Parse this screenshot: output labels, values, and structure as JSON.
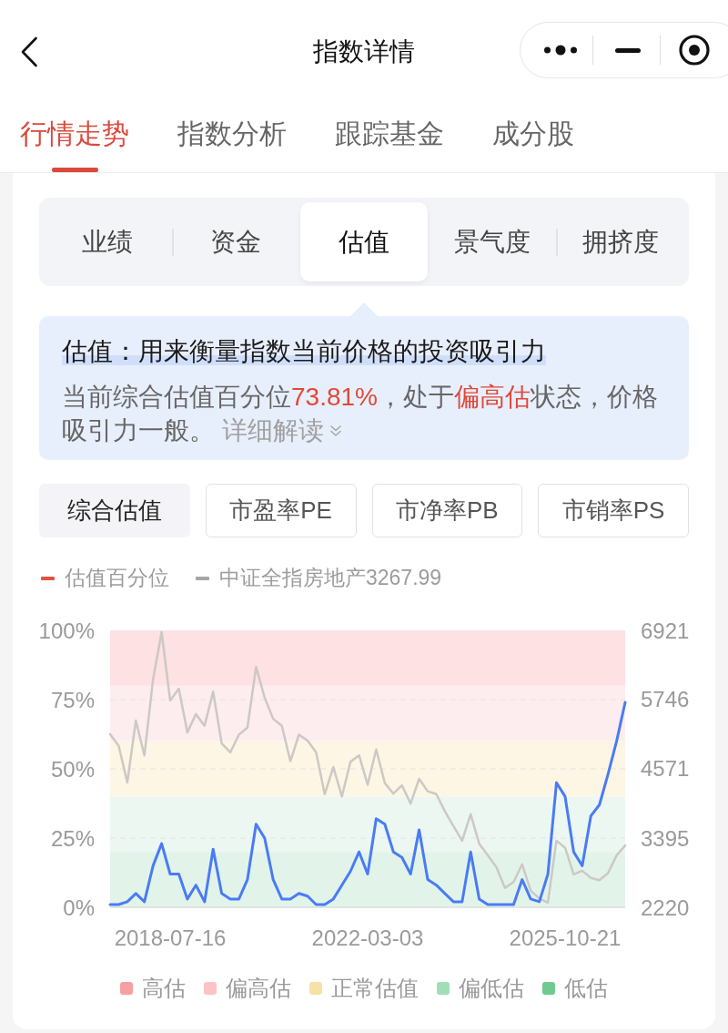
{
  "header": {
    "title": "指数详情"
  },
  "main_tabs": [
    {
      "label": "行情走势",
      "selected": true
    },
    {
      "label": "指数分析",
      "selected": false
    },
    {
      "label": "跟踪基金",
      "selected": false
    },
    {
      "label": "成分股",
      "selected": false
    }
  ],
  "section_tabs": [
    {
      "label": "业绩",
      "selected": false
    },
    {
      "label": "资金",
      "selected": false
    },
    {
      "label": "估值",
      "selected": true
    },
    {
      "label": "景气度",
      "selected": false
    },
    {
      "label": "拥挤度",
      "selected": false
    }
  ],
  "info": {
    "title": "估值：用来衡量指数当前价格的投资吸引力",
    "body": [
      {
        "text": "当前综合估值百分位",
        "emphasis": false
      },
      {
        "text": "73.81%",
        "emphasis": true
      },
      {
        "text": "，处于",
        "emphasis": false
      },
      {
        "text": "偏高估",
        "emphasis": true
      },
      {
        "text": "状态，价格吸引力一般。",
        "emphasis": false
      }
    ],
    "link": "详细解读"
  },
  "metric_tabs": [
    {
      "label": "综合估值",
      "selected": true
    },
    {
      "label": "市盈率PE",
      "selected": false
    },
    {
      "label": "市净率PB",
      "selected": false
    },
    {
      "label": "市销率PS",
      "selected": false
    }
  ],
  "chart": {
    "legend": [
      {
        "color": "#e0533f"
      },
      {
        "color": "#a6a6a6"
      }
    ],
    "chart_data": {
      "type": "line",
      "grid": true,
      "categories": [
        null,
        null,
        null,
        null,
        null,
        null,
        null,
        "2018-07-16",
        null,
        null,
        null,
        null,
        null,
        null,
        null,
        null,
        null,
        null,
        null,
        null,
        null,
        null,
        null,
        null,
        null,
        null,
        null,
        null,
        null,
        null,
        "2022-03-03",
        null,
        null,
        null,
        null,
        null,
        null,
        null,
        null,
        null,
        null,
        null,
        null,
        null,
        null,
        null,
        null,
        null,
        null,
        null,
        null,
        null,
        null,
        "2025-10-21",
        null,
        null,
        null,
        null,
        null,
        null,
        null
      ],
      "ylim": [
        0,
        100
      ],
      "yticks": [
        {
          "value": 0,
          "label": "0%"
        },
        {
          "value": 25,
          "label": "25%"
        },
        {
          "value": 50,
          "label": "50%"
        },
        {
          "value": 75,
          "label": "75%"
        },
        {
          "value": 100,
          "label": "100%"
        }
      ],
      "y2lim": [
        2220,
        6921
      ],
      "y2ticks": [
        2220,
        3395,
        4571,
        5746,
        6921
      ],
      "series": [
        {
          "name": "估值百分位",
          "color": "#4a7bf5",
          "values": [
            1,
            1,
            2,
            5,
            2,
            15,
            23,
            12,
            12,
            3,
            8,
            2,
            21,
            5,
            3,
            3,
            10,
            30,
            25,
            10,
            3,
            3,
            5,
            4,
            1,
            1,
            3,
            8,
            13,
            20,
            12,
            32,
            30,
            20,
            18,
            12,
            28,
            10,
            8,
            5,
            2,
            2,
            20,
            3,
            1,
            1,
            1,
            1,
            10,
            3,
            2,
            12,
            45,
            40,
            20,
            15,
            33,
            37,
            48,
            60,
            74
          ]
        },
        {
          "name": "中证全指房地产3267.99",
          "color": "#ccc8c6",
          "axis": "y2",
          "values": [
            5160,
            4960,
            4340,
            5390,
            4800,
            6090,
            6890,
            5730,
            5930,
            5190,
            5500,
            5300,
            5880,
            5000,
            4850,
            5150,
            5270,
            6300,
            5780,
            5420,
            5300,
            4700,
            5150,
            5050,
            4850,
            4140,
            4600,
            4100,
            4690,
            4800,
            4300,
            4900,
            4330,
            4150,
            4290,
            3980,
            4400,
            4190,
            4140,
            3850,
            3600,
            3350,
            3800,
            3300,
            3100,
            2900,
            2550,
            2650,
            2950,
            2500,
            2370,
            2300,
            3350,
            3230,
            2780,
            2840,
            2720,
            2680,
            2800,
            3100,
            3270
          ]
        }
      ],
      "bands": [
        {
          "axis": "y",
          "from": 80,
          "to": 100,
          "color": "#fde1e3"
        },
        {
          "axis": "y",
          "from": 60,
          "to": 80,
          "color": "#fdedef"
        },
        {
          "axis": "y",
          "from": 40,
          "to": 60,
          "color": "#fdf6e4"
        },
        {
          "axis": "y",
          "from": 20,
          "to": 40,
          "color": "#ecf7f1"
        },
        {
          "axis": "y",
          "from": 0,
          "to": 20,
          "color": "#e2f4ea"
        }
      ]
    },
    "zone_legend": [
      {
        "label": "高估",
        "color": "#f7a0a3"
      },
      {
        "label": "偏高估",
        "color": "#fcc3c6"
      },
      {
        "label": "正常估值",
        "color": "#f6e1a6"
      },
      {
        "label": "偏低估",
        "color": "#a3ddb7"
      },
      {
        "label": "低估",
        "color": "#6fca8f"
      }
    ]
  }
}
